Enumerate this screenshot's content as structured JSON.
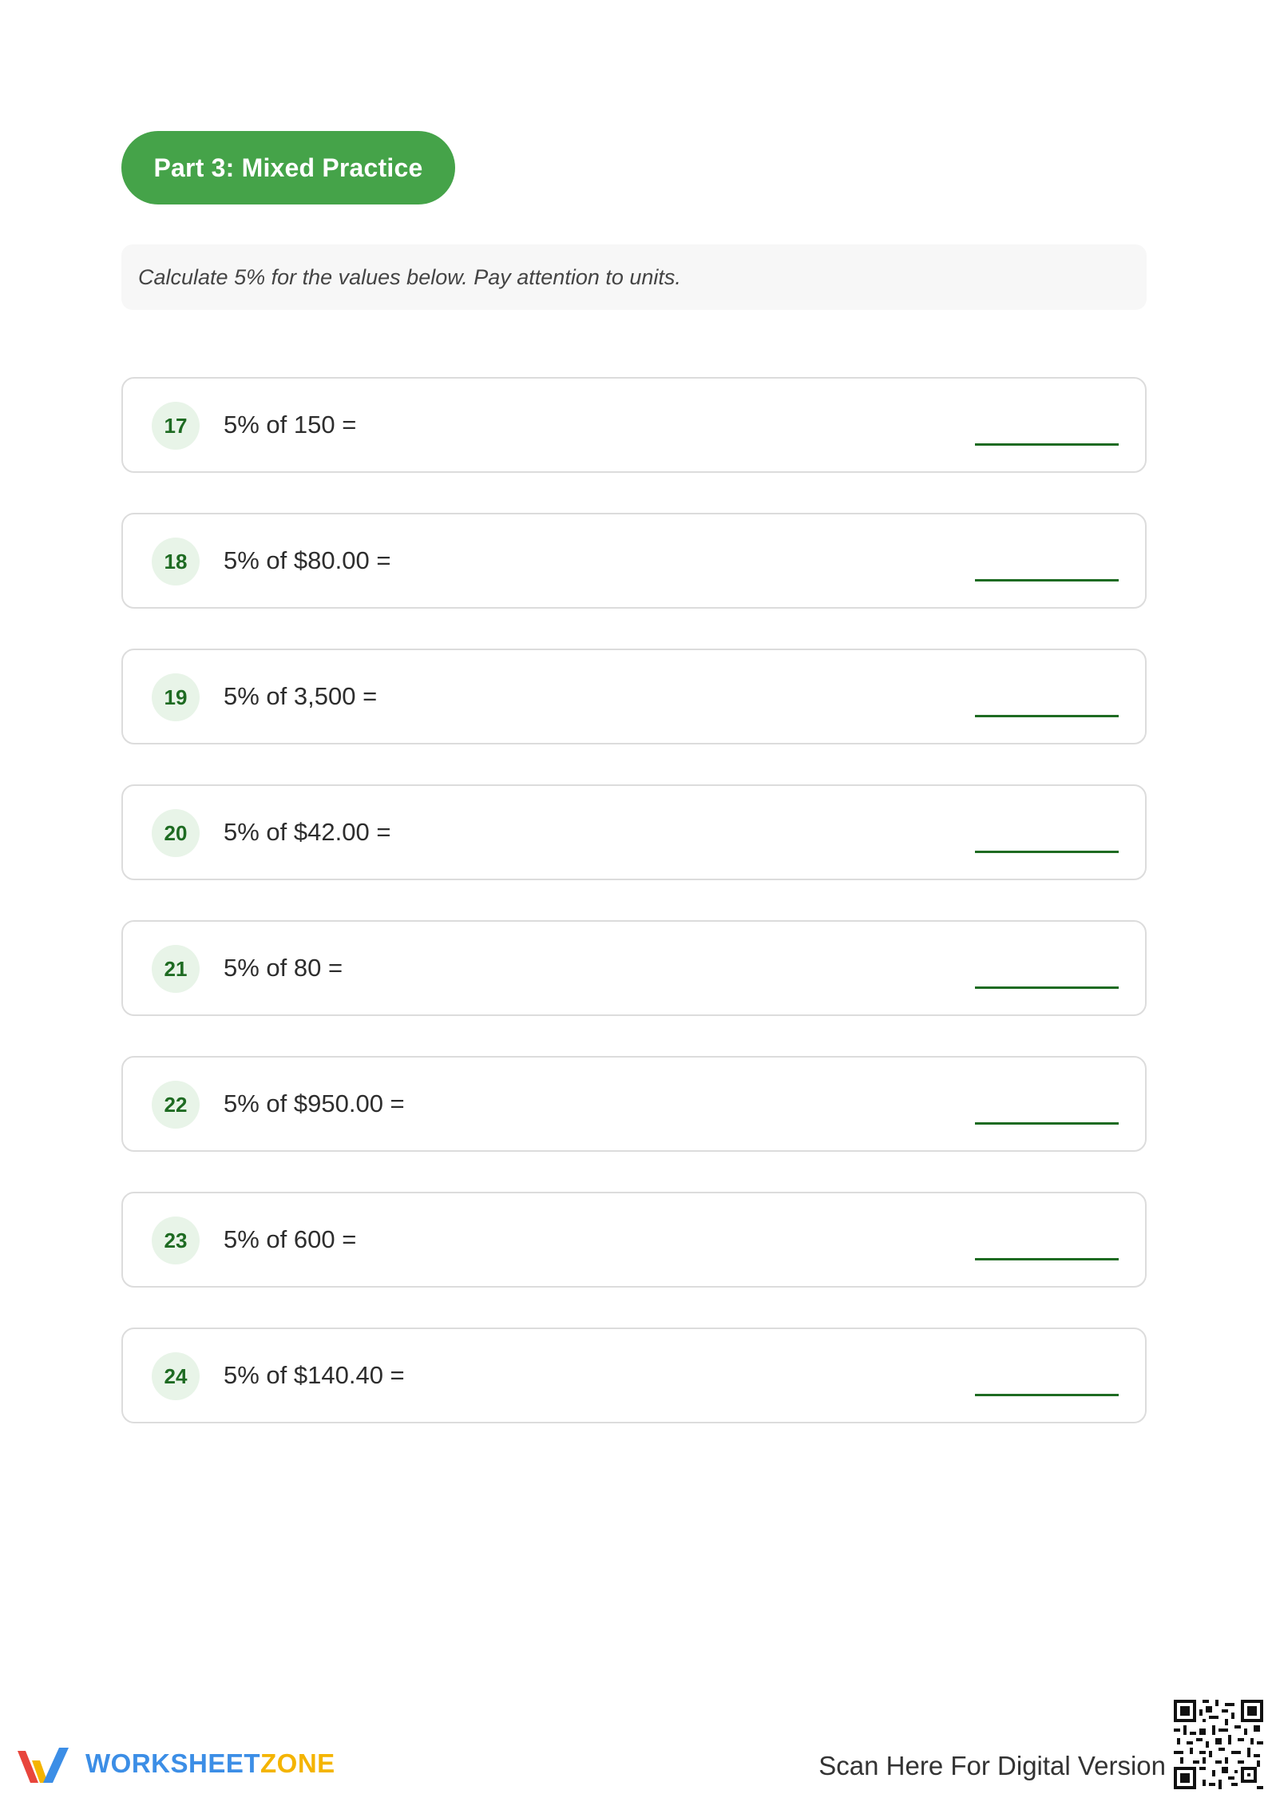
{
  "section": {
    "title": "Part 3: Mixed Practice",
    "accent_color": "#45a349"
  },
  "instruction": "Calculate 5% for the values below. Pay attention to units.",
  "problems": [
    {
      "number": "17",
      "question": "5% of 150 ="
    },
    {
      "number": "18",
      "question": "5% of $80.00 ="
    },
    {
      "number": "19",
      "question": "5% of 3,500 ="
    },
    {
      "number": "20",
      "question": "5% of $42.00 ="
    },
    {
      "number": "21",
      "question": "5% of 80 ="
    },
    {
      "number": "22",
      "question": "5% of $950.00 ="
    },
    {
      "number": "23",
      "question": "5% of 600 ="
    },
    {
      "number": "24",
      "question": "5% of $140.40 ="
    }
  ],
  "footer": {
    "brand_part1": "WORKSHEET",
    "brand_part2": "ZONE",
    "scan_text": "Scan Here For Digital Version",
    "logo_icon": "worksheetzone-logo-icon",
    "qr_icon": "qr-code-icon"
  }
}
